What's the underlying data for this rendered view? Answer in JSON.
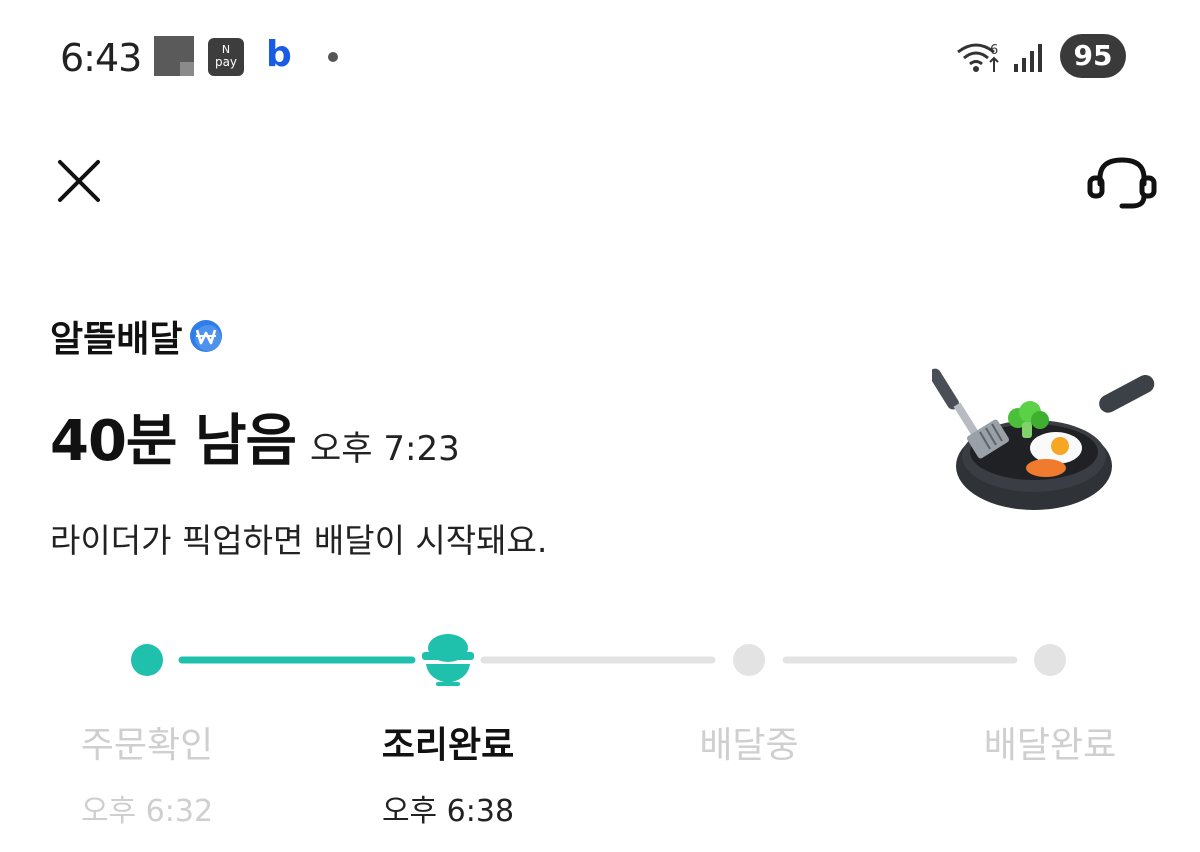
{
  "status_bar": {
    "time": "6:43",
    "pay_icon_text": [
      "N",
      "pay"
    ],
    "b_icon_text": "b",
    "battery": "95",
    "icons": [
      "square-notification-icon",
      "pay-icon",
      "b-app-icon",
      "dot-icon",
      "wifi-6-icon",
      "signal-icon",
      "battery-icon"
    ]
  },
  "header": {
    "close_icon": "close-icon",
    "support_icon": "headset-icon"
  },
  "order": {
    "brand": "알뜰배달",
    "remaining": "40분 남음",
    "eta": "오후 7:23",
    "message": "라이더가 픽업하면 배달이 시작돼요."
  },
  "progress": {
    "steps": [
      {
        "label": "주문확인",
        "time": "오후 6:32",
        "state": "done"
      },
      {
        "label": "조리완료",
        "time": "오후 6:38",
        "state": "current"
      },
      {
        "label": "배달중",
        "time": "",
        "state": "pending"
      },
      {
        "label": "배달완료",
        "time": "",
        "state": "pending"
      }
    ]
  },
  "colors": {
    "accent": "#1fc1ad",
    "inactive": "#e3e3e3",
    "muted_text": "#cfcfcf",
    "battery_bg": "#3a3a3a",
    "brand_badge": "#2f7ee8"
  }
}
